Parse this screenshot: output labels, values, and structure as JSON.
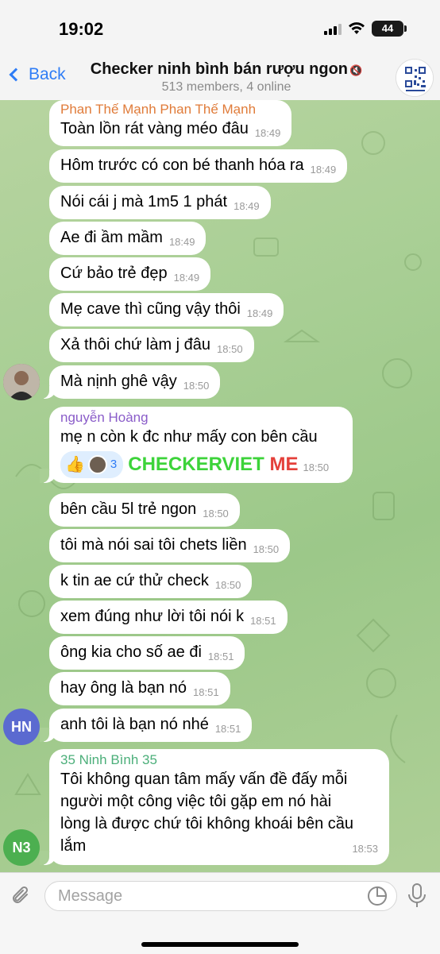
{
  "status_bar": {
    "time": "19:02",
    "battery": "44",
    "icons": [
      "cellular-signal-icon",
      "wifi-icon",
      "battery-icon"
    ]
  },
  "header": {
    "back_label": "Back",
    "title": "Checker ninh bình bán rượu ngon",
    "subtitle": "513 members, 4 online",
    "muted": true,
    "mute_icon": "muted-speaker-icon"
  },
  "messages": [
    {
      "sender": "Phan Thế Mạnh Phan Thế Mạnh",
      "sender_color": "#e07b39",
      "text": "Toàn lồn rát vàng méo đâu",
      "time": "18:49"
    },
    {
      "text": "Hôm trước có con bé thanh hóa ra",
      "time": "18:49"
    },
    {
      "text": "Nói cái j mà 1m5 1 phát",
      "time": "18:49"
    },
    {
      "text": "Ae đi ầm mầm",
      "time": "18:49"
    },
    {
      "text": "Cứ bảo trẻ đẹp",
      "time": "18:49"
    },
    {
      "text": "Mẹ cave thì cũng vậy thôi",
      "time": "18:49"
    },
    {
      "text": "Xả thôi chứ làm j đâu",
      "time": "18:50"
    },
    {
      "text": "Mà nịnh ghê vậy",
      "time": "18:50"
    },
    {
      "sender": "nguyễn Hoàng",
      "sender_color": "#8a5cc9",
      "text": "mẹ n còn k đc như mấy con bên cầu",
      "time": "18:50",
      "reaction_emoji": "👍",
      "reaction_count": "3",
      "watermark": "CHECKERVIET",
      "watermark_suffix": "ME"
    },
    {
      "text": "bên cầu 5l trẻ ngon",
      "time": "18:50"
    },
    {
      "text": "tôi mà nói sai tôi chets liền",
      "time": "18:50"
    },
    {
      "text": "k tin ae cứ thử check",
      "time": "18:50"
    },
    {
      "text": "xem đúng như lời tôi nói k",
      "time": "18:51"
    },
    {
      "text": "ông kia cho số ae đi",
      "time": "18:51"
    },
    {
      "text": "hay ông là bạn nó",
      "time": "18:51"
    },
    {
      "text": "anh tôi là bạn nó nhé",
      "time": "18:51"
    },
    {
      "sender": "35 Ninh Bình 35",
      "sender_color": "#4caf7a",
      "lines": [
        "Tôi không quan tâm mấy vấn đề đấy mỗi",
        "người một công việc tôi gặp em nó hài",
        "lòng là được chứ tôi không khoái bên cầu",
        "lắm"
      ],
      "time": "18:53"
    }
  ],
  "avatars": {
    "hn": {
      "initials": "HN",
      "color": "#5b6ad0"
    },
    "n3": {
      "initials": "N3",
      "color": "#4caf50"
    }
  },
  "composer": {
    "placeholder": "Message"
  }
}
